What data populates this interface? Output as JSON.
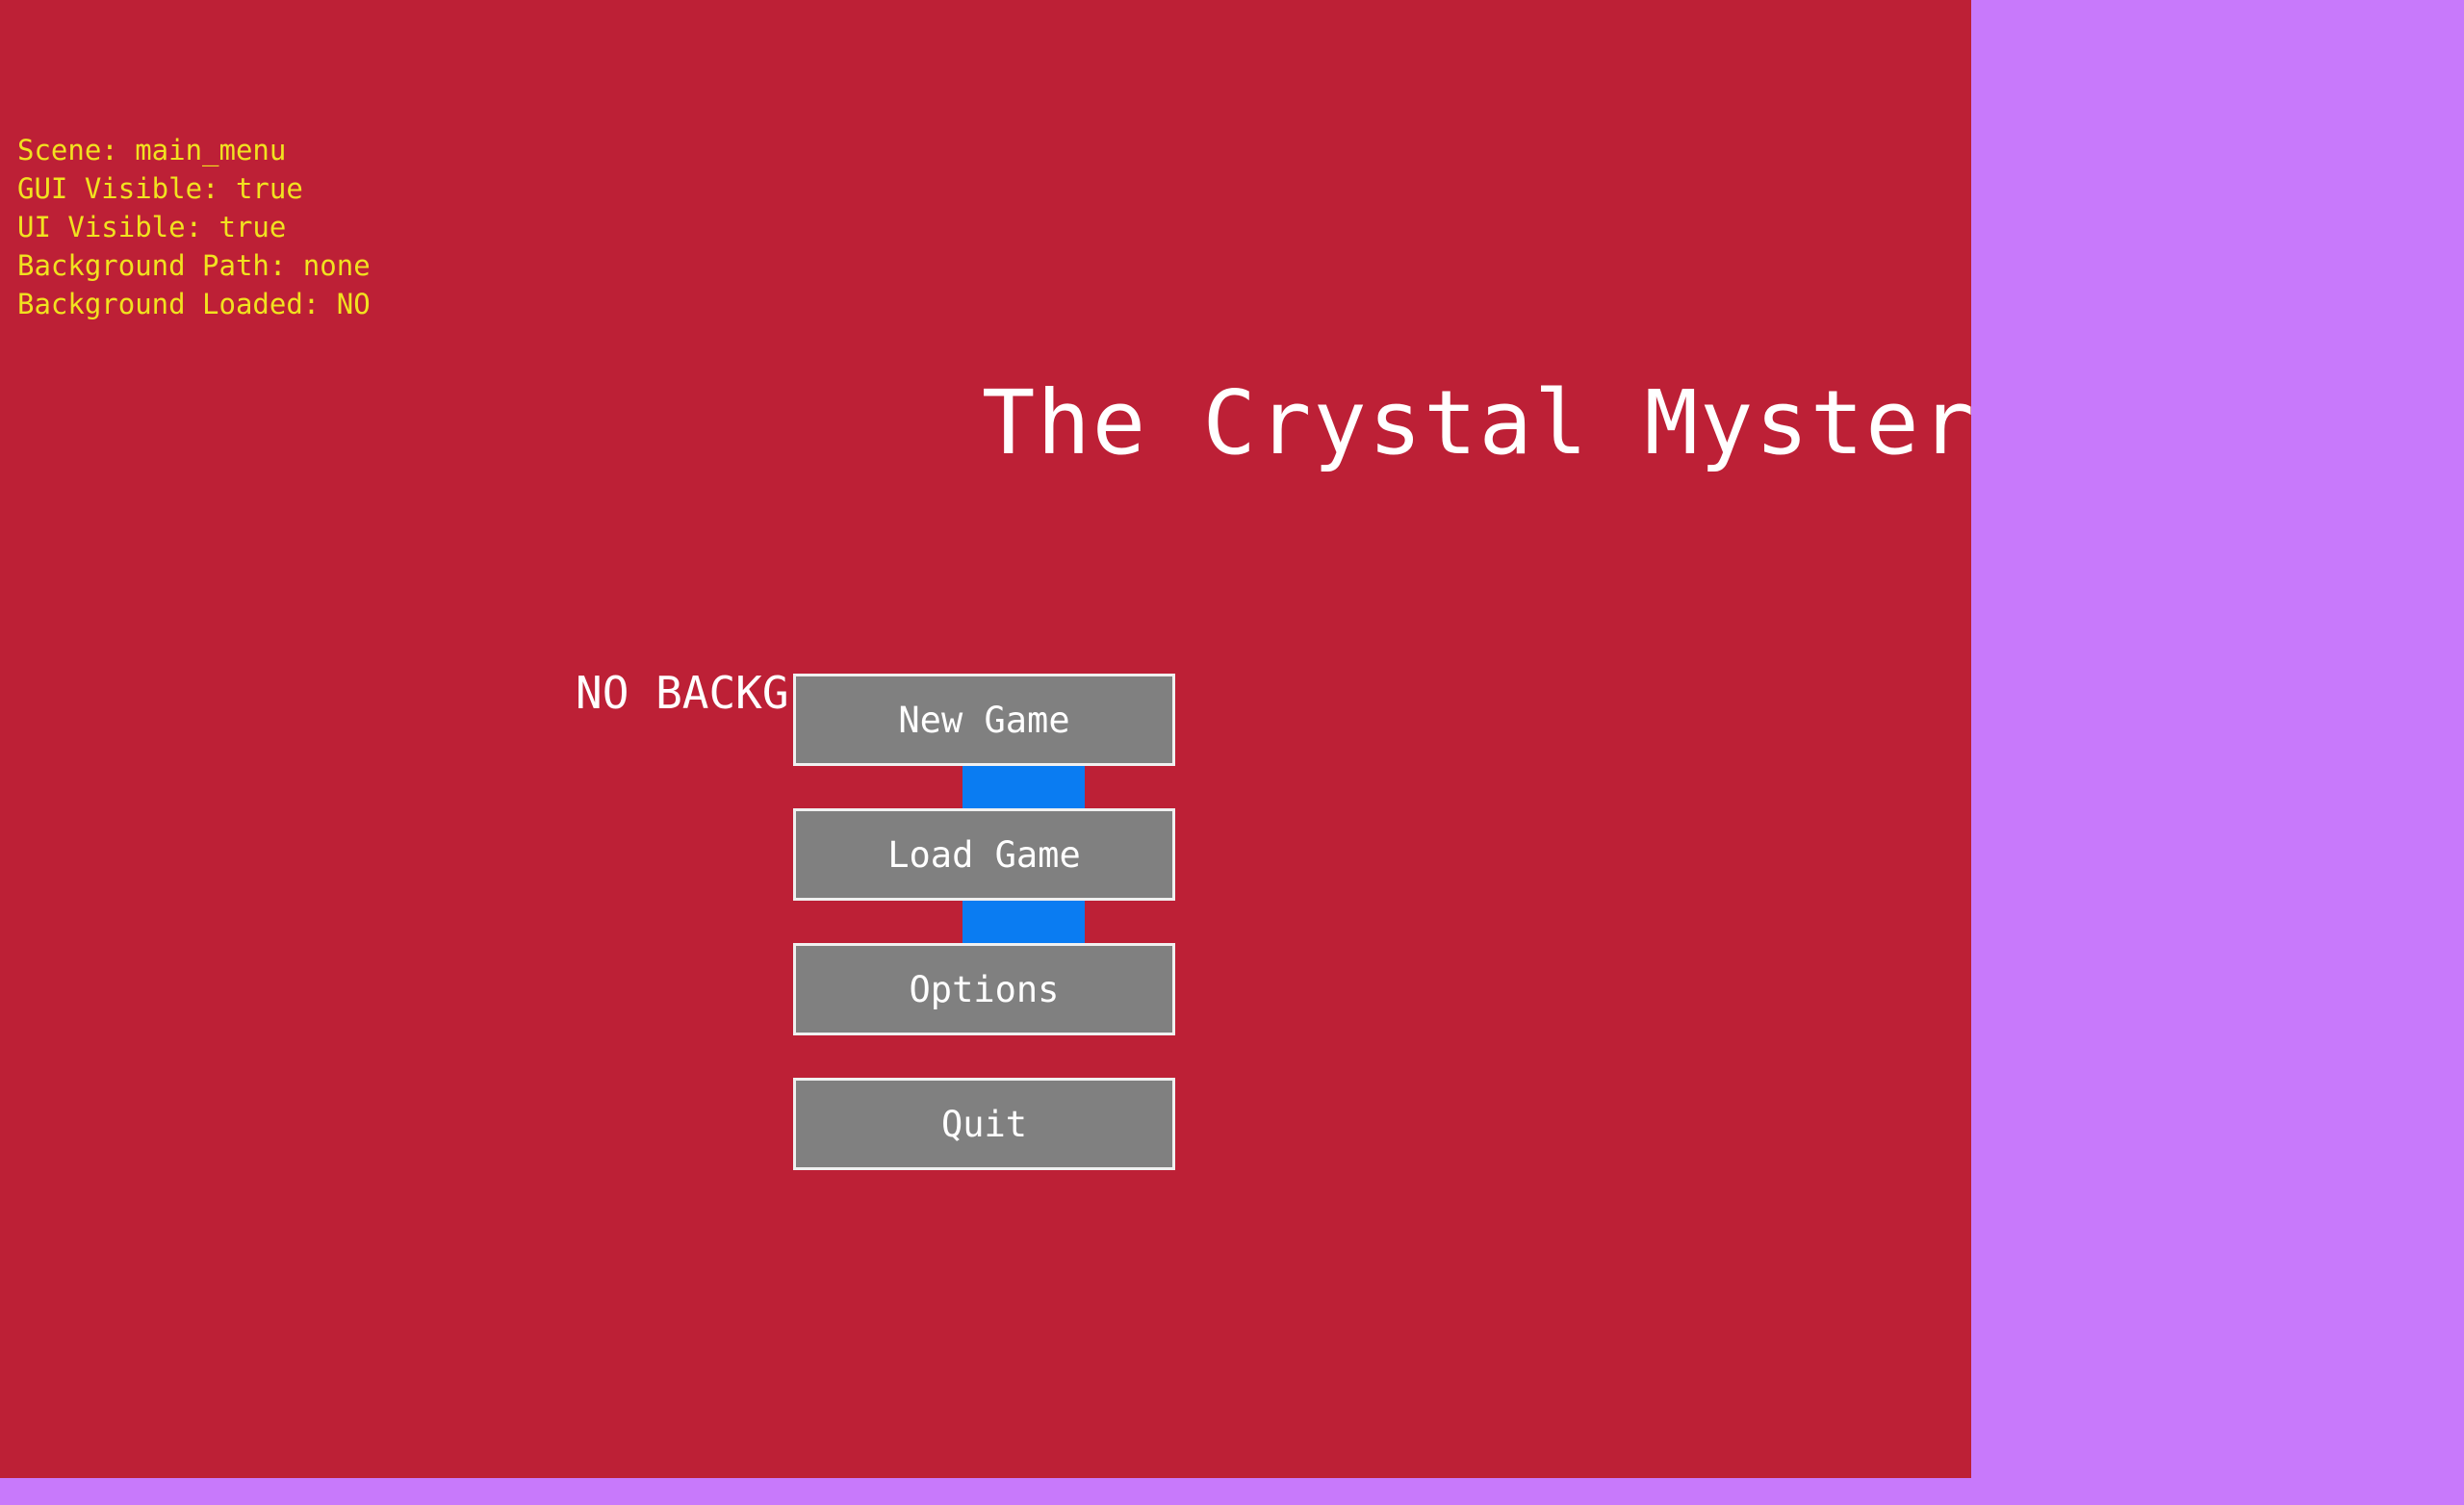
{
  "debug": {
    "scene": "Scene: main_menu",
    "gui_visible": "GUI Visible: true",
    "ui_visible": "UI Visible: true",
    "background_path": "Background Path: none",
    "background_loaded": "Background Loaded: NO"
  },
  "title": "The Crystal Mystery",
  "no_background_label": "NO BACKG",
  "menu": {
    "new_game": "New Game",
    "load_game": "Load Game",
    "options": "Options",
    "quit": "Quit"
  },
  "colors": {
    "viewport_background": "#bd2036",
    "window_background": "#c879fb",
    "debug_text": "#f1e21f",
    "button_fill": "#808080",
    "connector": "#0a7cf2"
  }
}
